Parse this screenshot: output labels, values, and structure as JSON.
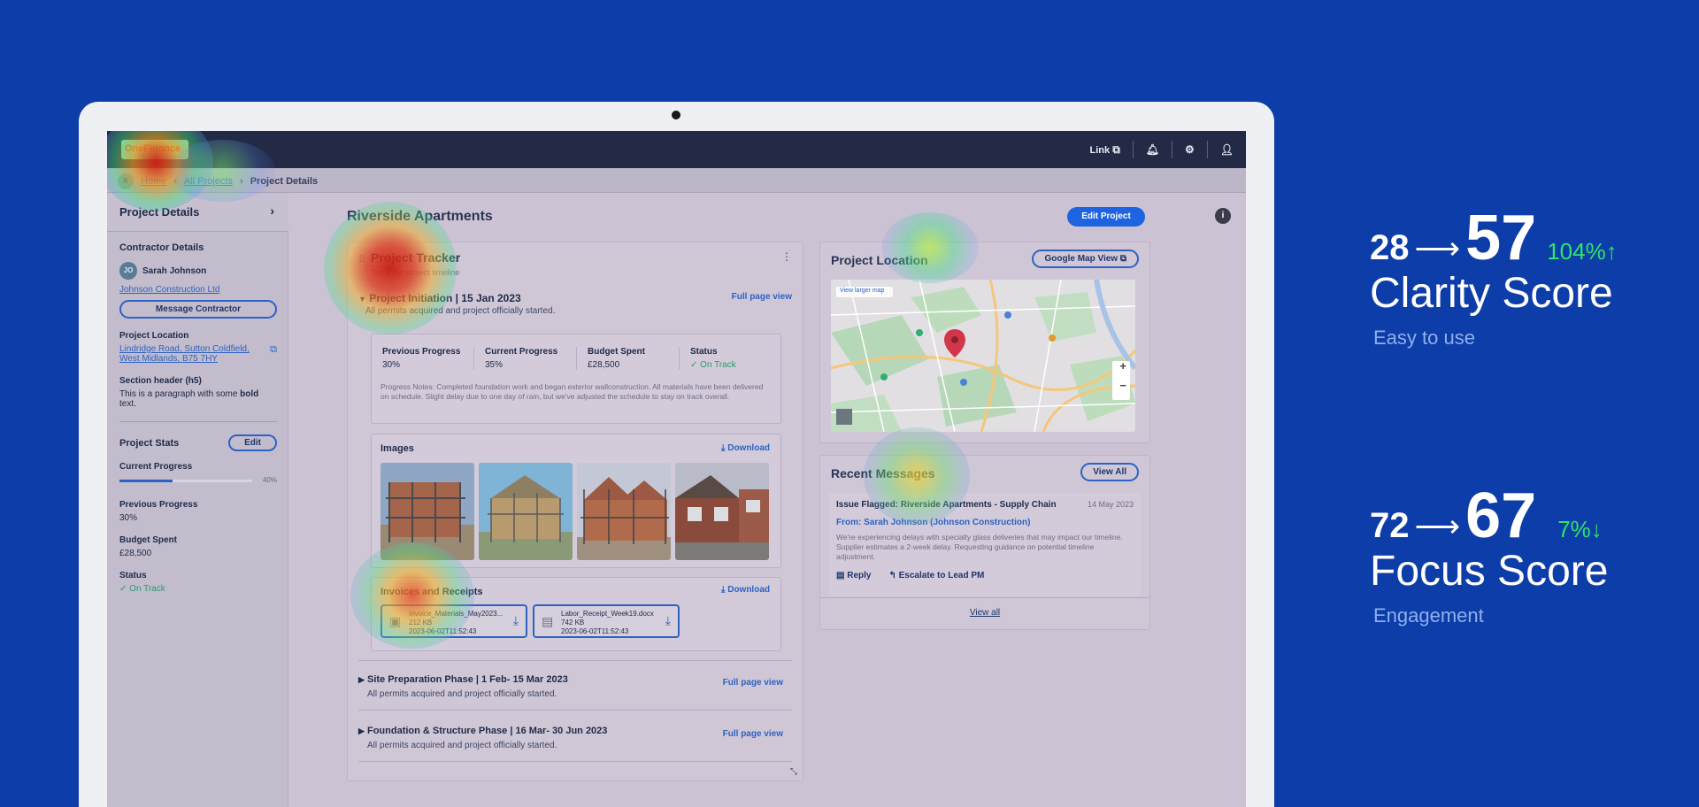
{
  "app": {
    "brand": "OneFinance",
    "topbar": {
      "link_label": "Link"
    }
  },
  "breadcrumb": {
    "items": [
      "Home",
      "All Projects"
    ],
    "current": "Project Details"
  },
  "sidebar": {
    "header": "Project Details",
    "contractor_title": "Contractor Details",
    "contractor_initials": "JO",
    "contractor_name": "Sarah Johnson",
    "contractor_company": "Johnson Construction Ltd",
    "message_button": "Message Contractor",
    "location_label": "Project Location",
    "location_address_1": "Lindridge Road, Sutton Coldfield,",
    "location_address_2": "West Midlands, B75 7HY",
    "section_header": "Section header (h5)",
    "paragraph_pre": "This is a paragraph with some ",
    "paragraph_bold": "bold",
    "paragraph_post": "text.",
    "stats_title": "Project Stats",
    "stats_edit": "Edit",
    "current_progress_label": "Current Progress",
    "current_progress_value": 40,
    "current_progress_text": "40%",
    "previous_progress_label": "Previous Progress",
    "previous_progress_value": "30%",
    "budget_label": "Budget Spent",
    "budget_value": "£28,500",
    "status_label": "Status",
    "status_value": "On Track"
  },
  "main": {
    "title": "Riverside Apartments",
    "edit_button": "Edit Project",
    "tracker": {
      "title": "Project Tracker",
      "subtitle": "Track the project timeline",
      "phase1": {
        "title": "Project Initiation | 15 Jan 2023",
        "sub": "All permits acquired and project officially started.",
        "link": "Full page view",
        "stats": [
          {
            "h": "Previous Progress",
            "v": "30%"
          },
          {
            "h": "Current Progress",
            "v": "35%"
          },
          {
            "h": "Budget Spent",
            "v": "£28,500"
          },
          {
            "h": "Status",
            "v": "On Track"
          }
        ],
        "notes": "Progress Notes: Completed foundation work and began exterior wallconstruction. All materials have been delivered on schedule. Slight delay due to one day of rain, but we've adjusted the schedule to stay on track overall."
      },
      "images": {
        "title": "Images",
        "download": "Download"
      },
      "invoices": {
        "title": "Invoices and Receipts",
        "download": "Download",
        "files": [
          {
            "name": "Invoice_Materials_May2023...",
            "size": "212 KB",
            "date": "2023-06-02T11:52:43"
          },
          {
            "name": "Labor_Receipt_Week19.docx",
            "size": "742 KB",
            "date": "2023-06-02T11:52:43"
          }
        ]
      },
      "phase2": {
        "title": "Site Preparation Phase | 1 Feb- 15 Mar 2023",
        "sub": "All permits acquired and project officially started.",
        "link": "Full page view"
      },
      "phase3": {
        "title": "Foundation & Structure Phase | 16 Mar- 30 Jun 2023",
        "sub": "All permits acquired and project officially started.",
        "link": "Full page view"
      }
    },
    "location": {
      "title": "Project Location",
      "button": "Google Map View",
      "map_link": "View larger map"
    },
    "messages": {
      "title": "Recent Messages",
      "button": "View All",
      "item": {
        "subject": "Issue Flagged: Riverside Apartments - Supply Chain",
        "date": "14 May 2023",
        "from": "From: Sarah Johnson (Johnson Construction)",
        "body": "We're experiencing delays with specialty glass deliveries that may impact our timeline. Supplier estimates a 2-week delay. Requesting guidance on potential timeline adjustment.",
        "reply": "Reply",
        "escalate": "Escalate to Lead PM"
      },
      "view_all_link": "View all"
    }
  },
  "metrics": [
    {
      "from": "28",
      "to": "57",
      "delta": "104%",
      "arrow": "↑",
      "label": "Clarity Score",
      "sub": "Easy to use"
    },
    {
      "from": "72",
      "to": "67",
      "delta": "7%",
      "arrow": "↓",
      "label": "Focus Score",
      "sub": "Engagement"
    }
  ],
  "colors": {
    "background": "#0d3da8",
    "accent": "#1e63e0",
    "positive": "#2ee36a"
  }
}
